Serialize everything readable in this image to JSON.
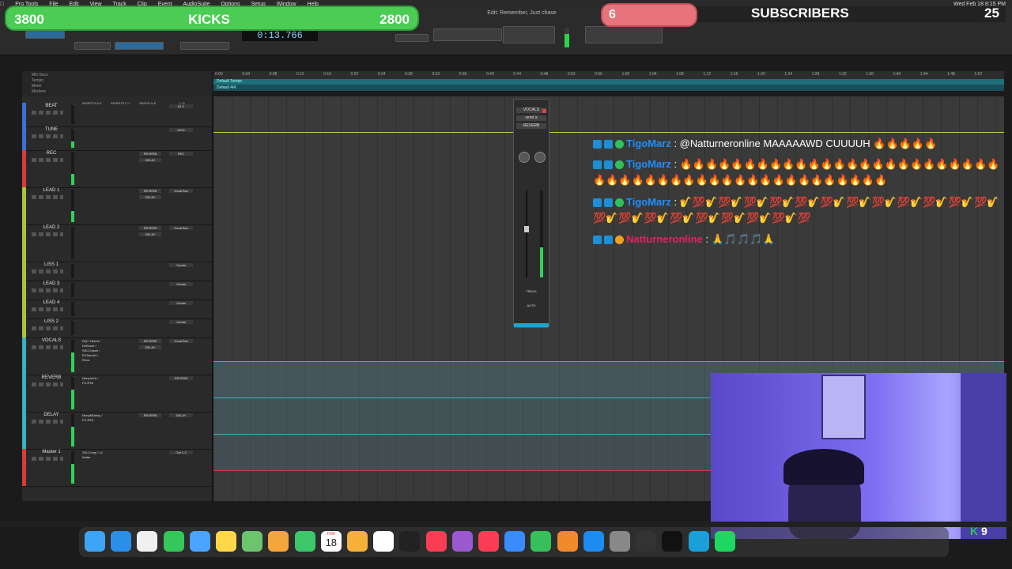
{
  "menubar": {
    "items": [
      "Pro Tools",
      "File",
      "Edit",
      "View",
      "Track",
      "Clip",
      "Event",
      "AudioSuite",
      "Options",
      "Setup",
      "Window",
      "Help"
    ],
    "clock": "Wed Feb 18  8:15 PM"
  },
  "toolbar": {
    "counter": "0:13.766",
    "window_title": "Edit: Remember, Just chase"
  },
  "overlay": {
    "kicks_left": "3800",
    "kicks_label": "KICKS",
    "kicks_right": "2800",
    "sub_count": "6",
    "sub_label": "SUBSCRIBERS",
    "sub_goal": "25"
  },
  "ruler": {
    "row_labels": [
      "Min:Secs",
      "Tempo",
      "Meter",
      "Markers"
    ],
    "ticks": [
      "0:00",
      "0:04",
      "0:08",
      "0:12",
      "0:16",
      "0:20",
      "0:24",
      "0:28",
      "0:32",
      "0:36",
      "0:40",
      "0:44",
      "0:48",
      "0:52",
      "0:56",
      "1:00",
      "1:04",
      "1:08",
      "1:12",
      "1:16",
      "1:20",
      "1:24",
      "1:28",
      "1:32",
      "1:36",
      "1:40",
      "1:44",
      "1:48",
      "1:52"
    ],
    "tempo_label": "Default Tempo",
    "meter_label": "Default 4/4"
  },
  "mix_headers": {
    "inserts_ae": "INSERTS A-E",
    "inserts_fj": "INSERTS F-J",
    "sends_ae": "SENDS A-E",
    "io": "I / O"
  },
  "tracks": [
    {
      "name": "BEAT",
      "color": "#3b6fd6",
      "plug": "",
      "io": "A1-2",
      "ins": ""
    },
    {
      "name": "TUNE",
      "color": "#3b6fd6",
      "plug": "",
      "io": "MOD",
      "ins": ""
    },
    {
      "name": "REC",
      "color": "#d93a3a",
      "plug": "REVERB",
      "plug2": "DELAY",
      "io": "REC",
      "ins": ""
    },
    {
      "name": "LEAD 1",
      "color": "#a8c43a",
      "plug": "REVERB",
      "plug2": "DELAY",
      "io": "Vocal Bus",
      "ins": ""
    },
    {
      "name": "LEAD 2",
      "color": "#a8c43a",
      "plug": "REVERB",
      "plug2": "DELAY",
      "io": "Vocal Bus",
      "ins": ""
    },
    {
      "name": "LISS 1",
      "color": "#a8c43a",
      "plug": "",
      "io": "Vocals",
      "ins": ""
    },
    {
      "name": "LEAD 3",
      "color": "#a8c43a",
      "plug": "",
      "io": "Vocals",
      "ins": ""
    },
    {
      "name": "LEAD 4",
      "color": "#a8c43a",
      "plug": "",
      "io": "Vocals",
      "ins": ""
    },
    {
      "name": "LISS 2",
      "color": "#a8c43a",
      "plug": "",
      "io": "Vocals",
      "ins": ""
    },
    {
      "name": "VOCALS",
      "color": "#3bb0c4",
      "plug": "REVERB",
      "plug2": "DELAY",
      "io": "Vocal Bus",
      "ins": "RQ7-1Band / DeEsser / SSLChanel / RChannel / RVox"
    },
    {
      "name": "REVERB",
      "color": "#3bb0c4",
      "plug": "",
      "io": "REVERB",
      "ins": "ManyVerb / FX-RTA"
    },
    {
      "name": "DELAY",
      "color": "#3bb0c4",
      "plug": "REVERB",
      "io": "DELAY",
      "ins": "ManyMDelay / FX-RTA"
    },
    {
      "name": "Master 1",
      "color": "#d93a3a",
      "plug": "",
      "io": "Out 1-2",
      "ins": "SSLComp / L1 limiter"
    }
  ],
  "floating_mixer": {
    "track": "VOCALS",
    "insert": "send a",
    "label1": "REVERB",
    "track_label": "TRACK",
    "auto_label": "AUTO"
  },
  "chat": [
    {
      "user": "TigoMarz",
      "user_color": "#1e90ff",
      "text": ": @Natturneronline MAAAAAWD CUUUUH 🔥🔥🔥🔥🔥"
    },
    {
      "user": "TigoMarz",
      "user_color": "#1e90ff",
      "text": ": 🔥🔥🔥🔥🔥🔥🔥🔥🔥🔥🔥🔥🔥🔥🔥🔥🔥🔥🔥🔥🔥🔥🔥🔥🔥🔥🔥🔥🔥🔥🔥🔥🔥🔥🔥🔥🔥🔥🔥🔥🔥🔥🔥🔥🔥🔥🔥🔥"
    },
    {
      "user": "TigoMarz",
      "user_color": "#1e90ff",
      "text": ": 🎷💯🎷💯🎷💯🎷💯🎷💯🎷💯🎷💯🎷💯🎷💯🎷💯🎷💯🎷💯🎷💯🎷💯🎷💯🎷💯🎷💯🎷💯🎷💯🎷💯🎷💯"
    },
    {
      "user": "Natturneronline",
      "user_color": "#e0245e",
      "text": ": 🙏🎵🎵🎵🙏"
    }
  ],
  "webcam": {
    "kick_count": "9"
  },
  "dock": {
    "icons": [
      "finder-icon",
      "safari-icon",
      "launchpad-icon",
      "messages-icon",
      "mail-icon",
      "notes-icon",
      "maps-icon",
      "photos-icon",
      "facetime-icon",
      "calendar-icon",
      "pages-icon",
      "reminders-icon",
      "appletv-icon",
      "music-icon",
      "podcasts-icon",
      "news-icon",
      "keynote-icon",
      "numbers-icon",
      "pages-icon",
      "appstore-icon",
      "system-prefs-icon",
      "garageband-icon",
      "ilok-icon",
      "obs-icon",
      "spotify-icon"
    ],
    "calendar_day": "18",
    "calendar_month": "FEB"
  }
}
